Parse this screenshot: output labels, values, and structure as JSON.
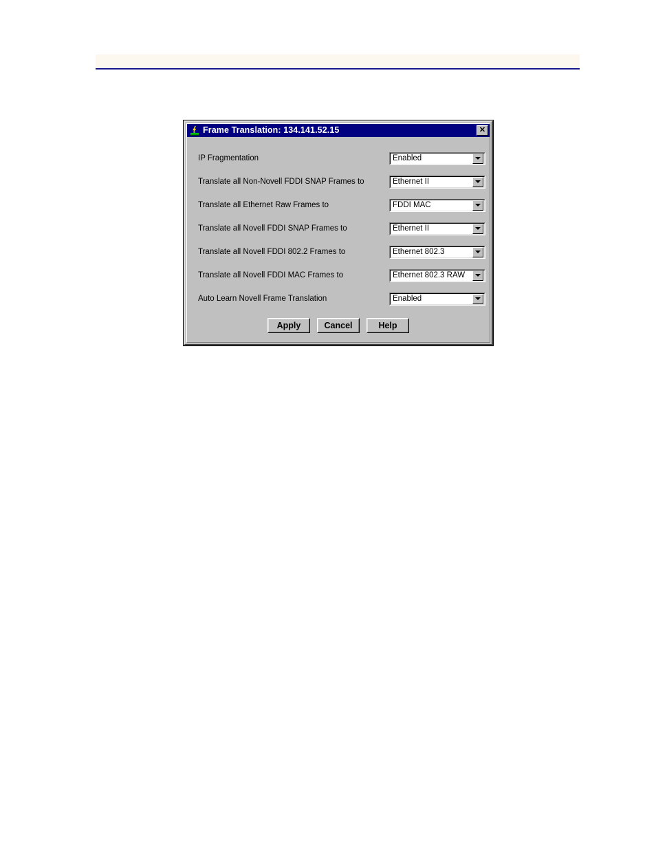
{
  "page": {
    "background": "#ffffff",
    "header_band_color": "#fdf8ef",
    "header_rule_color": "#18188c",
    "header_text": ""
  },
  "dialog": {
    "titlebar": {
      "icon": "network-device-lightning-icon",
      "title": "Frame Translation: 134.141.52.15",
      "close_label": "✕",
      "background": "#000080",
      "text_color": "#ffffff"
    },
    "face_color": "#c0c0c0",
    "rows": [
      {
        "label": "IP Fragmentation",
        "value": "Enabled",
        "name": "ip-fragmentation"
      },
      {
        "label": "Translate all Non-Novell FDDI SNAP Frames to",
        "value": "Ethernet II",
        "name": "non-novell-fddi-snap"
      },
      {
        "label": "Translate all Ethernet Raw Frames to",
        "value": "FDDI MAC",
        "name": "ethernet-raw"
      },
      {
        "label": "Translate all Novell FDDI SNAP Frames to",
        "value": "Ethernet II",
        "name": "novell-fddi-snap"
      },
      {
        "label": "Translate all Novell FDDI 802.2 Frames to",
        "value": "Ethernet 802.3",
        "name": "novell-fddi-802-2"
      },
      {
        "label": "Translate all Novell FDDI MAC Frames to",
        "value": "Ethernet 802.3 RAW",
        "name": "novell-fddi-mac"
      },
      {
        "label": "Auto Learn Novell Frame Translation",
        "value": "Enabled",
        "name": "auto-learn-novell"
      }
    ],
    "buttons": [
      {
        "label": "Apply",
        "name": "apply-button"
      },
      {
        "label": "Cancel",
        "name": "cancel-button"
      },
      {
        "label": "Help",
        "name": "help-button"
      }
    ]
  }
}
